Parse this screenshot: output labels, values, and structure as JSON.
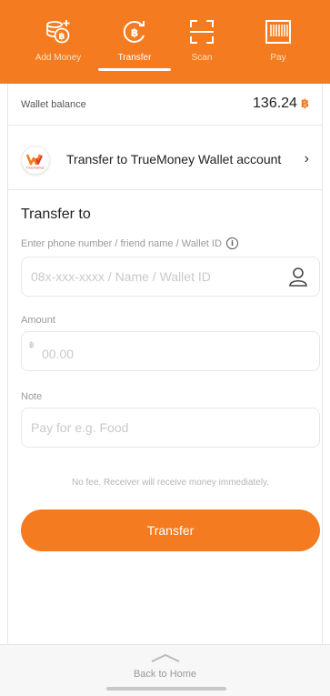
{
  "colors": {
    "brand_orange": "#f47b20",
    "text_dark": "#222222",
    "placeholder": "#c9c9c9"
  },
  "topnav": {
    "tabs": [
      {
        "label": "Add Money",
        "icon": "add-money-icon"
      },
      {
        "label": "Transfer",
        "icon": "transfer-icon",
        "active": true
      },
      {
        "label": "Scan",
        "icon": "scan-icon"
      },
      {
        "label": "Pay",
        "icon": "pay-barcode-icon"
      }
    ]
  },
  "balance": {
    "label": "Wallet balance",
    "amount": "136.24",
    "currency_symbol": "฿"
  },
  "transfer_type": {
    "label": "Transfer to TrueMoney Wallet account",
    "logo_caption": "truemoney"
  },
  "form": {
    "title": "Transfer to",
    "recipient": {
      "label": "Enter phone number / friend name / Wallet ID",
      "placeholder": "08x-xxx-xxxx / Name / Wallet ID"
    },
    "amount": {
      "label": "Amount",
      "placeholder": "00.00",
      "currency_symbol": "฿"
    },
    "note": {
      "label": "Note",
      "placeholder": "Pay for e.g. Food"
    },
    "fee_note": "No fee. Receiver will receive money immediately.",
    "submit_label": "Transfer"
  },
  "footer": {
    "back_label": "Back to Home"
  }
}
